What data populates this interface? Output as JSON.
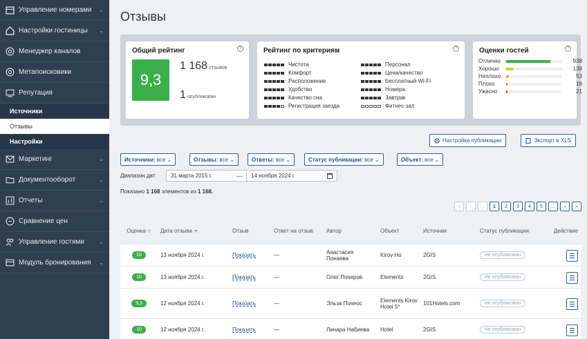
{
  "sidebar": {
    "items": [
      {
        "label": "Управление номерами",
        "icon": "calendar-icon"
      },
      {
        "label": "Настройки гостиницы",
        "icon": "hotel-icon"
      },
      {
        "label": "Менеджер каналов",
        "icon": "channels-icon"
      },
      {
        "label": "Метапоисковики",
        "icon": "search-icon"
      },
      {
        "label": "Репутация",
        "icon": "reputation-icon"
      },
      {
        "label": "Маркетинг",
        "icon": "mail-icon"
      },
      {
        "label": "Документооборот",
        "icon": "folder-icon"
      },
      {
        "label": "Отчеты",
        "icon": "chart-icon"
      },
      {
        "label": "Сравнение цен",
        "icon": "compare-icon"
      },
      {
        "label": "Управление гостями",
        "icon": "users-icon"
      },
      {
        "label": "Модуль бронирования",
        "icon": "booking-icon"
      }
    ],
    "sub": [
      "Источники",
      "Отзывы",
      "Настройки"
    ]
  },
  "page": {
    "title": "Отзывы"
  },
  "overall": {
    "title": "Общий рейтинг",
    "score": "9,3",
    "reviews_count": "1 168",
    "reviews_label": "отзывов",
    "published_count": "1",
    "published_label": "опубликован"
  },
  "criteria": {
    "title": "Рейтинг по критериям",
    "items": [
      {
        "label": "Чистота",
        "filled": 5
      },
      {
        "label": "Комфорт",
        "filled": 5
      },
      {
        "label": "Расположение",
        "filled": 5
      },
      {
        "label": "Удобство",
        "filled": 5
      },
      {
        "label": "Качество сна",
        "filled": 5
      },
      {
        "label": "Регистрация заезда",
        "filled": 4
      },
      {
        "label": "Персонал",
        "filled": 5
      },
      {
        "label": "Цена/качество",
        "filled": 5
      },
      {
        "label": "Бесплатный Wi-Fi",
        "filled": 5
      },
      {
        "label": "Номера",
        "filled": 5
      },
      {
        "label": "Завтрак",
        "filled": 5
      },
      {
        "label": "Фитнес-зал",
        "filled": 0
      }
    ]
  },
  "guests": {
    "title": "Оценки гостей",
    "rows": [
      {
        "label": "Отлично",
        "value": "938",
        "fraction": 0.8,
        "color": "#3daf4a"
      },
      {
        "label": "Хорошо",
        "value": "139",
        "fraction": 0.12,
        "color": "#c9d22f"
      },
      {
        "label": "Неплохо",
        "value": "53",
        "fraction": 0.05,
        "color": "#f0b429"
      },
      {
        "label": "Плохо",
        "value": "16",
        "fraction": 0.02,
        "color": "#f08a29"
      },
      {
        "label": "Ужасно",
        "value": "21",
        "fraction": 0.02,
        "color": "#e04b3c"
      }
    ]
  },
  "actions": {
    "publish_settings": "Настройка публикации",
    "export": "Экспорт в XLS"
  },
  "filters": {
    "sources_label": "Источники:",
    "sources_value": "все",
    "reviews_label": "Отзывы:",
    "reviews_value": "все",
    "answers_label": "Ответы:",
    "answers_value": "все",
    "status_label": "Статус публикации:",
    "status_value": "все",
    "object_label": "Объект:",
    "object_value": "все"
  },
  "date_range": {
    "label": "Диапазон дат:",
    "from": "31 марта 2015 г.",
    "separator": "—",
    "to": "14 ноября 2024 г."
  },
  "shown": {
    "prefix": "Показано",
    "count": "1 168",
    "middle": "элементов из",
    "total": "1 168."
  },
  "pager": [
    "«",
    "‹",
    "…",
    "1",
    "2",
    "3",
    "4",
    "5",
    "…",
    "›",
    "»"
  ],
  "table": {
    "headers": [
      "Оценка",
      "Дата отзыва",
      "Отзыв",
      "Ответ на отзыв",
      "Автор",
      "Объект",
      "Источник",
      "Статус публикации",
      "Действие"
    ],
    "rows": [
      {
        "score": "10",
        "date": "13 ноября 2024 г.",
        "review": "Показать",
        "answer": "—",
        "author": "Анастасия Понаева",
        "object": "Kirov Ho",
        "source": "2GIS",
        "status": "Не опубликован"
      },
      {
        "score": "10",
        "date": "13 ноября 2024 г.",
        "review": "Показать",
        "answer": "—",
        "author": "Олег Почеров",
        "object": "Elements",
        "source": "2GIS",
        "status": "Не опубликован"
      },
      {
        "score": "9,3",
        "date": "12 ноября 2024 г.",
        "review": "Показать",
        "answer": "—",
        "author": "Эльза Почеос",
        "object": "Elements Kirov Hotel 5*",
        "source": "101Hotels.com",
        "status": "Не опубликован"
      },
      {
        "score": "10",
        "date": "12 ноября 2024 г.",
        "review": "Показать",
        "answer": "—",
        "author": "Линара Набиева",
        "object": "Hotel",
        "source": "2GIS",
        "status": "Не опубликован"
      }
    ]
  }
}
